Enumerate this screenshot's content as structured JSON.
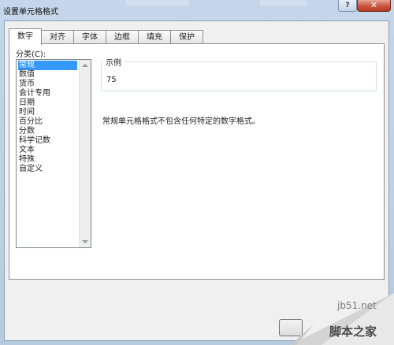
{
  "window": {
    "title": "设置单元格格式"
  },
  "tabs": [
    {
      "label": "数字",
      "active": true
    },
    {
      "label": "对齐",
      "active": false
    },
    {
      "label": "字体",
      "active": false
    },
    {
      "label": "边框",
      "active": false
    },
    {
      "label": "填充",
      "active": false
    },
    {
      "label": "保护",
      "active": false
    }
  ],
  "category": {
    "label": "分类(C):",
    "selected": "常规",
    "items": [
      "常规",
      "数值",
      "货币",
      "会计专用",
      "日期",
      "时间",
      "百分比",
      "分数",
      "科学记数",
      "文本",
      "特殊",
      "自定义"
    ]
  },
  "sample": {
    "legend": "示例",
    "value": "75"
  },
  "description": "常规单元格格式不包含任何特定的数字格式。",
  "watermark": {
    "site": "jb51.net",
    "brand": "脚本之家"
  },
  "icons": {
    "help": "help-icon",
    "close": "close-icon"
  },
  "colors": {
    "selection": "#3399ff",
    "close_button": "#c9543c"
  }
}
